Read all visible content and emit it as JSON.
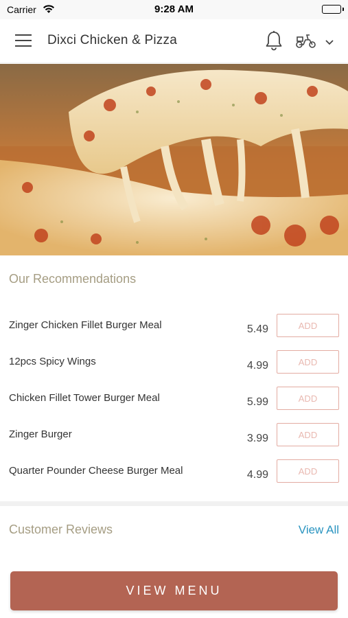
{
  "status_bar": {
    "carrier": "Carrier",
    "time": "9:28 AM"
  },
  "header": {
    "title": "Dixci Chicken & Pizza",
    "icons": [
      "menu-icon",
      "bell-icon",
      "scooter-icon",
      "chevron-down-icon"
    ]
  },
  "hero": {
    "image": "pizza-cheese-pull-photo"
  },
  "recommendations": {
    "title": "Our Recommendations",
    "items": [
      {
        "name": "Zinger Chicken Fillet Burger Meal",
        "price": "5.49",
        "action": "ADD"
      },
      {
        "name": "12pcs Spicy Wings",
        "price": "4.99",
        "action": "ADD"
      },
      {
        "name": "Chicken Fillet Tower Burger Meal",
        "price": "5.99",
        "action": "ADD"
      },
      {
        "name": "Zinger Burger",
        "price": "3.99",
        "action": "ADD"
      },
      {
        "name": "Quarter Pounder Cheese Burger Meal",
        "price": "4.99",
        "action": "ADD"
      }
    ]
  },
  "reviews": {
    "title": "Customer Reviews",
    "view_all": "View All"
  },
  "footer": {
    "view_menu_label": "VIEW MENU"
  },
  "colors": {
    "accent": "#b36453",
    "section_title": "#a59d83",
    "link": "#2a94c0",
    "add_border": "#e3aba1"
  }
}
